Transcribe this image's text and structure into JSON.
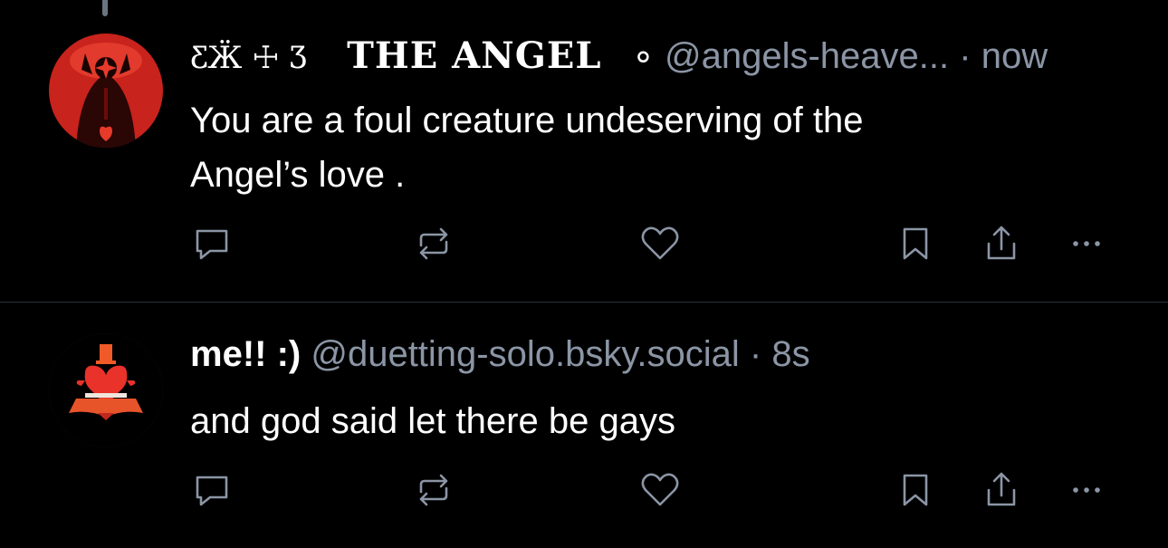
{
  "posts": [
    {
      "name_deco_left": "ƸӜ ☩ Ʒ",
      "name": "THE ANGEL",
      "name_deco_right": "∘",
      "handle": "@angels-heave...",
      "separator": "·",
      "time": "now",
      "body_line1": "You are a foul creature undeserving of the",
      "body_line2": "Angel’s love .",
      "avatar_icon": "red-angel-avatar"
    },
    {
      "name": "me!! :)",
      "handle": "@duetting-solo.bsky.social",
      "separator": "·",
      "time": "8s",
      "body_line1": "and god said let there be gays",
      "avatar_icon": "heart-tophat-avatar"
    }
  ],
  "actions": [
    "reply-icon",
    "repost-icon",
    "like-icon",
    "bookmark-icon",
    "share-icon",
    "more-icon"
  ],
  "colors": {
    "background": "#000000",
    "text": "#ffffff",
    "muted": "#8b95a5",
    "divider": "#2a2e35"
  }
}
